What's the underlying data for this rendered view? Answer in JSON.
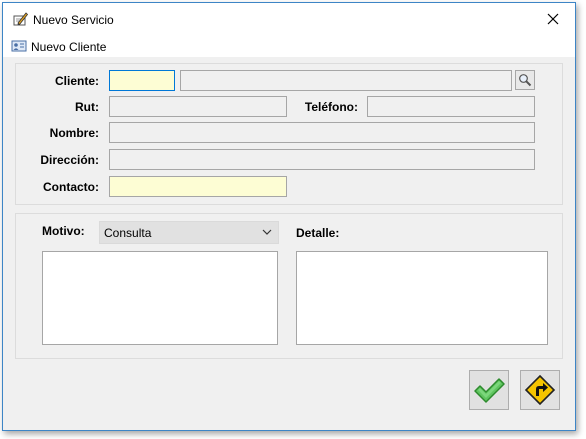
{
  "window": {
    "title": "Nuevo Servicio"
  },
  "menu": {
    "new_client_label": "Nuevo Cliente"
  },
  "form": {
    "cliente_label": "Cliente:",
    "cliente_code": "",
    "cliente_name": "",
    "rut_label": "Rut:",
    "rut_value": "",
    "telefono_label": "Teléfono:",
    "telefono_value": "",
    "nombre_label": "Nombre:",
    "nombre_value": "",
    "direccion_label": "Dirección:",
    "direccion_value": "",
    "contacto_label": "Contacto:",
    "contacto_value": ""
  },
  "service": {
    "motivo_label": "Motivo:",
    "motivo_selected": "Consulta",
    "detalle_label": "Detalle:"
  },
  "colors": {
    "required_field": "#fdfdd4",
    "focus_border": "#0078d7",
    "confirm": "#3aa53a",
    "next": "#f5c400"
  },
  "icons": {
    "title": "pencil-document-icon",
    "menu": "new-client-card-icon",
    "search": "magnifier-icon",
    "confirm": "green-checkmark-icon",
    "next": "yellow-turn-arrow-sign-icon"
  }
}
